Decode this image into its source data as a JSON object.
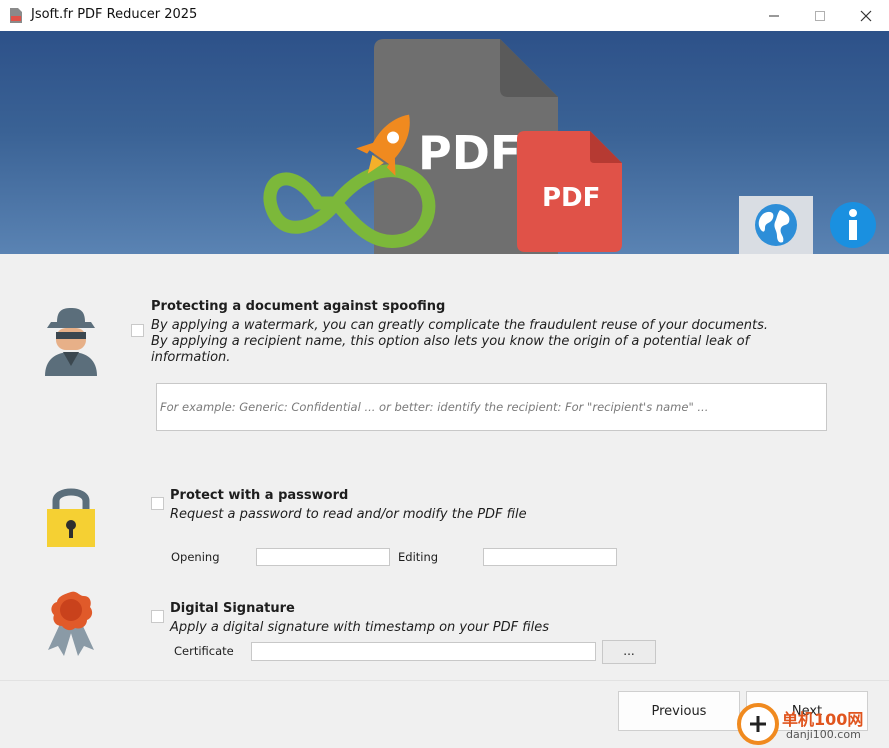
{
  "window": {
    "title": "Jsoft.fr PDF Reducer 2025",
    "minimize": "—",
    "maximize": "☐",
    "close": "✕"
  },
  "banner": {
    "big_doc_text": "PDF",
    "small_doc_text": "PDF",
    "colors": {
      "gray_doc": "#6f6f6f",
      "red_doc": "#e05248",
      "rocket": "#f08a1f",
      "infinity": "#7cb83a"
    }
  },
  "spoofing": {
    "title": "Protecting a document against spoofing",
    "desc_line1": "By applying a watermark, you can greatly complicate the fraudulent reuse of your documents.",
    "desc_line2": "By applying a recipient name, this option also lets you know the origin of a potential leak of",
    "desc_line3": "information.",
    "placeholder": "For example: Generic: Confidential ... or better: identify the recipient: For \"recipient's name\" ..."
  },
  "password": {
    "title": "Protect with a password",
    "desc": "Request a password to read and/or modify the PDF file",
    "opening_label": "Opening",
    "editing_label": "Editing",
    "opening_value": "",
    "editing_value": ""
  },
  "signature": {
    "title": "Digital Signature",
    "desc": "Apply a digital signature with timestamp on your PDF files",
    "certificate_label": "Certificate",
    "certificate_value": "",
    "browse_label": "..."
  },
  "footer": {
    "previous_label": "Previous",
    "next_label": "Next"
  },
  "watermark": {
    "site_cn": "单机100网",
    "site_url": "danji100.com"
  }
}
